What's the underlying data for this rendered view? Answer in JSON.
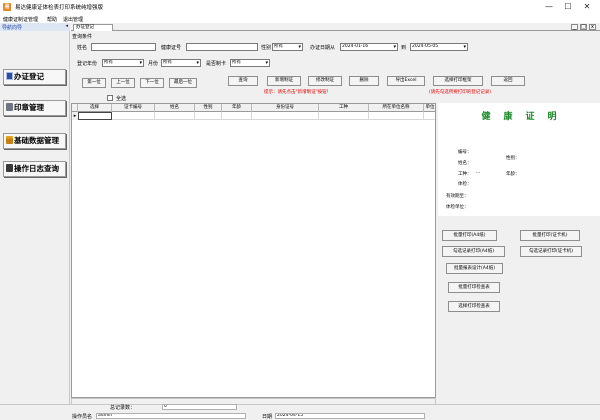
{
  "window": {
    "title": "易达健康证体检表打印系统纯增强版",
    "app_icon_glyph": "易",
    "minimize_glyph": "—",
    "maximize_glyph": "☐",
    "close_glyph": "✕"
  },
  "menu": {
    "items": [
      "健康证制证管理",
      "帮助",
      "退出管理"
    ]
  },
  "nav": {
    "header": "导航向导",
    "pin_glyph": "◂",
    "buttons": [
      {
        "label": "办证登记",
        "icon": "register-icon"
      },
      {
        "label": "印章管理",
        "icon": "printer-icon"
      },
      {
        "label": "基础数据管理",
        "icon": "database-icon"
      },
      {
        "label": "操作日志查询",
        "icon": "log-icon"
      }
    ]
  },
  "mdi": {
    "tab_label": "办证登记",
    "tab_close": "x",
    "ctrl_min": "_",
    "ctrl_restore": "□",
    "ctrl_close": "x"
  },
  "query": {
    "group_label": "查询条件",
    "name_label": "姓名",
    "name_value": "",
    "cert_no_label": "健康证号",
    "cert_no_value": "",
    "gender_label": "性别",
    "gender_value": "所有",
    "date_label": "办证日期从",
    "date_from": "2024-01-16",
    "date_to_label": "到",
    "date_to": "2024-05-05",
    "year_label": "登记年份",
    "year_value": "所有",
    "month_label": "月份",
    "month_value": "所有",
    "made_label": "是否制卡",
    "made_value": "所有",
    "select_all_label": "全选"
  },
  "buttons": {
    "first": "第一位",
    "prev": "上一位",
    "next": "下一位",
    "last": "最后一位",
    "query": "查询",
    "add": "新增制证",
    "edit": "修改制证",
    "delete": "删除",
    "export": "导出Excel",
    "select_print": "选择打印框架",
    "back": "返回"
  },
  "hints": {
    "left": "提示：请先点击\"新增制证\"按钮！",
    "right": "(请先勾选所要打印的登记记录)"
  },
  "grid": {
    "columns": [
      "选择",
      "证卡编号",
      "姓名",
      "性别",
      "年龄",
      "身份证号",
      "工种",
      "所在单位名称",
      "单位"
    ],
    "indicator": "▸"
  },
  "card": {
    "title": "健康证明",
    "fields": {
      "serial": "编号：",
      "name": "姓名：",
      "gender": "性别：",
      "job": "工种：",
      "job_dots": "···",
      "age": "年龄：",
      "body_check": "体检：",
      "valid": "有效期至：",
      "unit": "体检单位："
    }
  },
  "print_buttons": {
    "batch_a4": "批量打印(A4纸)",
    "batch_card": "批量打印(证卡机)",
    "selected_a4": "勾选记录打印(A4纸)",
    "selected_card": "勾选记录打印(证卡机)",
    "batch_report_design": "批量报表设计(A4纸)",
    "batch_check_table": "批量打印检查表",
    "selected_check_table": "选择打印检查表"
  },
  "status": {
    "total_label": "总记录数：",
    "total_value": "0",
    "operator_label": "操作员名",
    "operator_value": "admin",
    "date_label": "日期",
    "date_value": "2024-04-15"
  }
}
